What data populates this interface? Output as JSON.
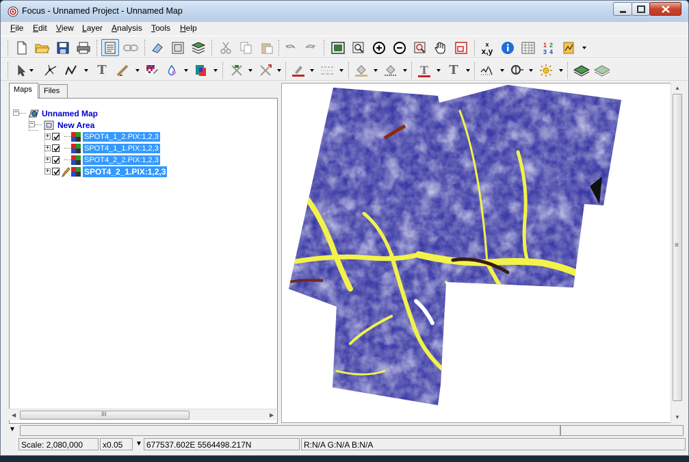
{
  "window": {
    "title": "Focus - Unnamed Project - Unnamed Map"
  },
  "menu": [
    {
      "label": "File",
      "accel": "F",
      "rest": "ile"
    },
    {
      "label": "Edit",
      "accel": "E",
      "rest": "dit"
    },
    {
      "label": "View",
      "accel": "V",
      "rest": "iew"
    },
    {
      "label": "Layer",
      "accel": "L",
      "rest": "ayer"
    },
    {
      "label": "Analysis",
      "accel": "A",
      "rest": "nalysis"
    },
    {
      "label": "Tools",
      "accel": "T",
      "rest": "ools"
    },
    {
      "label": "Help",
      "accel": "H",
      "rest": "elp"
    }
  ],
  "toolbar": {
    "coord_label_top": "x",
    "coord_label": "x,y",
    "number_grid_label": "1234",
    "text_tool_glyph": "T"
  },
  "tabs": {
    "maps": "Maps",
    "files": "Files"
  },
  "tree": {
    "map": "Unnamed Map",
    "area": "New Area",
    "layers": [
      {
        "label": "SPOT4_1_2.PIX:1,2,3"
      },
      {
        "label": "SPOT4_1_1.PIX:1,2,3"
      },
      {
        "label": "SPOT4_2_2.PIX:1,2,3"
      },
      {
        "label": "SPOT4_2_1.PIX:1,2,3"
      }
    ]
  },
  "status": {
    "scale": "Scale: 2,080,000",
    "zoom": "x0.05",
    "coordinates": "677537.602E 5564498.217N",
    "rgb": "R:N/A G:N/A B:N/A"
  },
  "colors": {
    "selection": "#3399ff",
    "tree_text": "#0000cc",
    "image_base": "#3a3aa8",
    "image_highlight": "#f2f24a"
  },
  "scroll": {
    "h_thumb_label": "III",
    "v_thumb_label": "≡"
  }
}
